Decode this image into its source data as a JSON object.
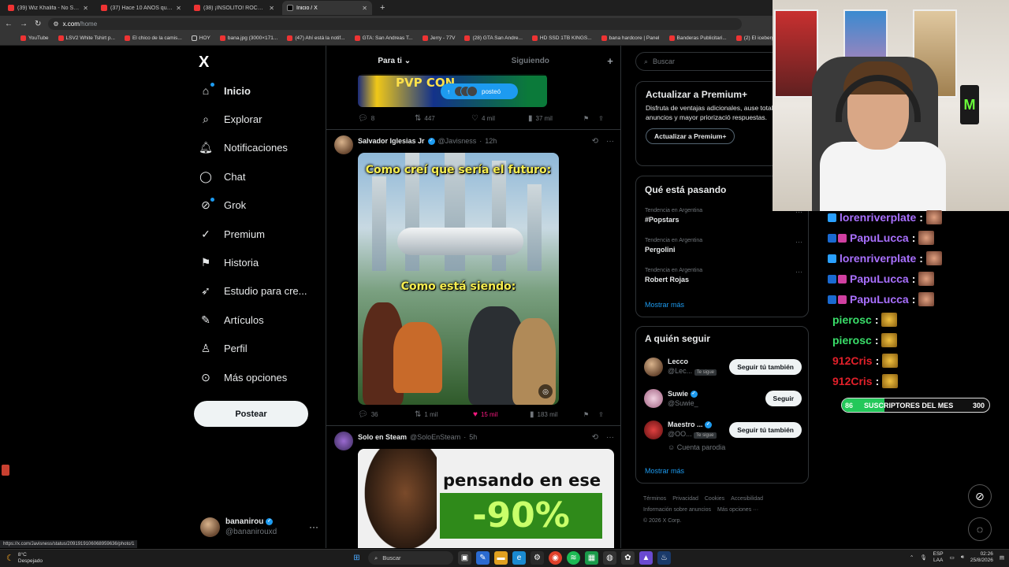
{
  "browser": {
    "tabs": [
      {
        "label": "(39) Wiz Khalifa - No Sleep [M...",
        "active": false
      },
      {
        "label": "(37) Hace 10 AÑOS que a Rock...",
        "active": false
      },
      {
        "label": "(38) ¡INSÓLITO! ROCKSTAR GA...",
        "active": false
      },
      {
        "label": "Inicio / X",
        "active": true
      }
    ],
    "new_tab": "+",
    "url_host": "x.com",
    "url_path": "/home",
    "bookmarks": [
      "YouTube",
      "LSV2 White Tshirt p...",
      "El chico de la camis...",
      "HOY",
      "bana.jpg (3000×171...",
      "(47) Ahí está la notif...",
      "GTA: San Andreas T...",
      "Jerry - 77V",
      "(28) GTA San Andre...",
      "HD SSD 1TB KINGS...",
      "bana hardcore | Panel",
      "Banderas Publicitari...",
      "(2) El iceberg de las...",
      "(2) El"
    ],
    "status_url": "https://x.com/Javisness/status/2091919106068959636/photo/1"
  },
  "nav": {
    "logo": "X",
    "items": [
      {
        "label": "Inicio",
        "icon": "home-icon",
        "active": true,
        "dot": true
      },
      {
        "label": "Explorar",
        "icon": "search-icon"
      },
      {
        "label": "Notificaciones",
        "icon": "bell-icon"
      },
      {
        "label": "Chat",
        "icon": "chat-bubble-icon"
      },
      {
        "label": "Grok",
        "icon": "grok-icon",
        "dot": true
      },
      {
        "label": "Premium",
        "icon": "verified-icon"
      },
      {
        "label": "Historia",
        "icon": "bookmark-icon"
      },
      {
        "label": "Estudio para cre...",
        "icon": "rocket-icon"
      },
      {
        "label": "Artículos",
        "icon": "article-icon"
      },
      {
        "label": "Perfil",
        "icon": "person-icon"
      },
      {
        "label": "Más opciones",
        "icon": "more-circle-icon"
      }
    ],
    "post_label": "Postear",
    "account": {
      "name": "bananirou",
      "handle": "@bananirouxd",
      "more": "···"
    }
  },
  "feed": {
    "tabs": [
      "Para ti",
      "Siguiendo"
    ],
    "plus": "+",
    "banner_text": "PVP CON",
    "posted_label": "posteó",
    "top_actions": {
      "replies": "8",
      "reposts": "447",
      "likes": "4 mil",
      "views": "37 mil"
    },
    "tweet1": {
      "name": "Salvador Iglesias Jr",
      "handle": "@Javisness",
      "time": "12h",
      "caption_top": "Como creí que sería el futuro:",
      "caption_mid": "Como está siendo:",
      "actions": {
        "replies": "36",
        "reposts": "1 mil",
        "likes": "15 mil",
        "views": "183 mil"
      }
    },
    "tweet2": {
      "name": "Solo en Steam",
      "handle": "@SoloEnSteam",
      "time": "5h",
      "img_text": "pensando en ese",
      "img_pct": "-90%"
    }
  },
  "sidebar": {
    "search_placeholder": "Buscar",
    "premium": {
      "title": "Actualizar a Premium+",
      "desc": "Disfruta de ventajas adicionales, ause total de anuncios y mayor priorizació respuestas.",
      "button": "Actualizar a Premium+"
    },
    "trends": {
      "title": "Qué está pasando",
      "items": [
        {
          "context": "Tendencia en Argentina",
          "name": "#Popstars"
        },
        {
          "context": "Tendencia en Argentina",
          "name": "Pergolini"
        },
        {
          "context": "Tendencia en Argentina",
          "name": "Robert Rojas"
        }
      ],
      "show_more": "Mostrar más"
    },
    "follow": {
      "title": "A quién seguir",
      "items": [
        {
          "name": "Lecco",
          "handle": "@Lec...",
          "badge": "Te sigue",
          "button": "Seguir tú también"
        },
        {
          "name": "Suwie",
          "handle": "@Suwie_",
          "badge": "",
          "button": "Seguir"
        },
        {
          "name": "Maestro ...",
          "handle": "@OO...",
          "badge": "Te sigue",
          "button": "Seguir tú también",
          "note": "Cuenta parodia"
        }
      ],
      "show_more": "Mostrar más"
    },
    "footer": {
      "links": [
        "Términos",
        "Privacidad",
        "Cookies",
        "Accesibilidad"
      ],
      "links2": [
        "Información sobre anuncios",
        "Más opciones ···"
      ],
      "copyright": "© 2026 X Corp."
    }
  },
  "stream": {
    "chat": [
      {
        "user": "lorenriverplate",
        "color": "#a970ff",
        "sep": ":"
      },
      {
        "user": "PapuLucca",
        "color": "#a970ff",
        "sep": ":"
      },
      {
        "user": "lorenriverplate",
        "color": "#a970ff",
        "sep": ":"
      },
      {
        "user": "PapuLucca",
        "color": "#a970ff",
        "sep": ":"
      },
      {
        "user": "PapuLucca",
        "color": "#a970ff",
        "sep": ":"
      },
      {
        "user": "pierosc",
        "color": "#3adf6a",
        "sep": ":"
      },
      {
        "user": "pierosc",
        "color": "#3adf6a",
        "sep": ":"
      },
      {
        "user": "912Cris",
        "color": "#e0202a",
        "sep": ":"
      },
      {
        "user": "912Cris",
        "color": "#e0202a",
        "sep": ":"
      }
    ],
    "sub_bar": {
      "current": "86",
      "title": "SUSCRIPTORES DEL MES",
      "target": "300",
      "progress": 0.287
    },
    "can_logo": "M"
  },
  "taskbar": {
    "temp": "8°C",
    "weather": "Despejado",
    "search": "Buscar",
    "lang": "ESP",
    "lang2": "LAA",
    "time": "02:26",
    "date": "25/8/2026"
  },
  "colors": {
    "accent": "#1d9bf0",
    "like": "#f91880",
    "bg": "#000000",
    "border": "#2f3336"
  }
}
